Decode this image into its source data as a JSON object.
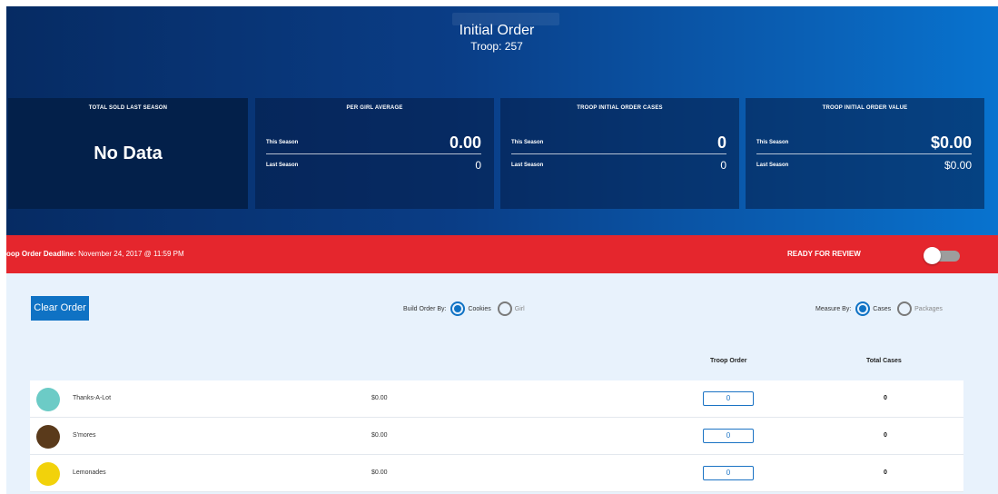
{
  "header": {
    "title": "Initial Order",
    "subtitle": "Troop: 257"
  },
  "cards": [
    {
      "title": "TOTAL SOLD LAST SEASON",
      "value": "No Data"
    },
    {
      "title": "PER GIRL AVERAGE",
      "this_label": "This Season",
      "this_value": "0.00",
      "last_label": "Last Season",
      "last_value": "0"
    },
    {
      "title": "TROOP INITIAL ORDER CASES",
      "this_label": "This Season",
      "this_value": "0",
      "last_label": "Last Season",
      "last_value": "0"
    },
    {
      "title": "TROOP INITIAL ORDER VALUE",
      "this_label": "This Season",
      "this_value": "$0.00",
      "last_label": "Last Season",
      "last_value": "$0.00"
    }
  ],
  "deadline": {
    "label": "oop Order Deadline:",
    "value": " November 24, 2017 @ 11:59 PM"
  },
  "review": {
    "label": "READY FOR REVIEW",
    "toggle_on": false
  },
  "controls": {
    "clear_label": "Clear Order",
    "build_label": "Build Order By:",
    "build_options": [
      "Cookies",
      "Girl"
    ],
    "build_selected": "Cookies",
    "measure_label": "Measure By:",
    "measure_options": [
      "Cases",
      "Packages"
    ],
    "measure_selected": "Cases"
  },
  "table": {
    "headers": {
      "troop_order": "Troop Order",
      "total_cases": "Total Cases"
    },
    "rows": [
      {
        "name": "Thanks-A-Lot",
        "price": "$0.00",
        "qty": "0",
        "total": "0",
        "color": "#6ccbc6"
      },
      {
        "name": "S'mores",
        "price": "$0.00",
        "qty": "0",
        "total": "0",
        "color": "#5a3a1b"
      },
      {
        "name": "Lemonades",
        "price": "$0.00",
        "qty": "0",
        "total": "0",
        "color": "#f2d20b"
      }
    ]
  },
  "colors": {
    "accent": "#0f72c4",
    "alert": "#e5262d",
    "header_dark": "#062b63"
  }
}
